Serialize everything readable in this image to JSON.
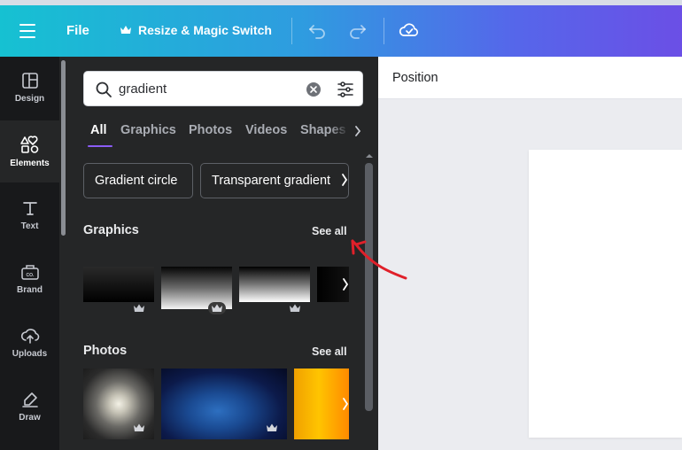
{
  "header": {
    "menu_file": "File",
    "menu_resize": "Resize & Magic Switch",
    "icons": [
      "hamburger-icon",
      "crown-icon",
      "undo-icon",
      "redo-icon",
      "cloud-saved-icon"
    ]
  },
  "rail": {
    "items": [
      {
        "label": "Design",
        "icon": "layout-icon"
      },
      {
        "label": "Elements",
        "icon": "shapes-icon",
        "active": true
      },
      {
        "label": "Text",
        "icon": "text-icon"
      },
      {
        "label": "Brand",
        "icon": "brand-kit-icon"
      },
      {
        "label": "Uploads",
        "icon": "cloud-upload-icon"
      },
      {
        "label": "Draw",
        "icon": "pen-icon"
      }
    ]
  },
  "search": {
    "value": "gradient"
  },
  "tabs": [
    "All",
    "Graphics",
    "Photos",
    "Videos",
    "Shapes"
  ],
  "active_tab": "All",
  "chips": [
    "Gradient circle",
    "Transparent gradient"
  ],
  "sections": {
    "graphics": {
      "title": "Graphics",
      "see_all": "See all"
    },
    "photos": {
      "title": "Photos",
      "see_all": "See all"
    }
  },
  "canvas": {
    "toolbar_position": "Position"
  },
  "colors": {
    "accent_tab": "#8b5cf6",
    "annotation_arrow": "#e0202a",
    "panel_bg": "#252627",
    "rail_bg": "#18191b"
  }
}
